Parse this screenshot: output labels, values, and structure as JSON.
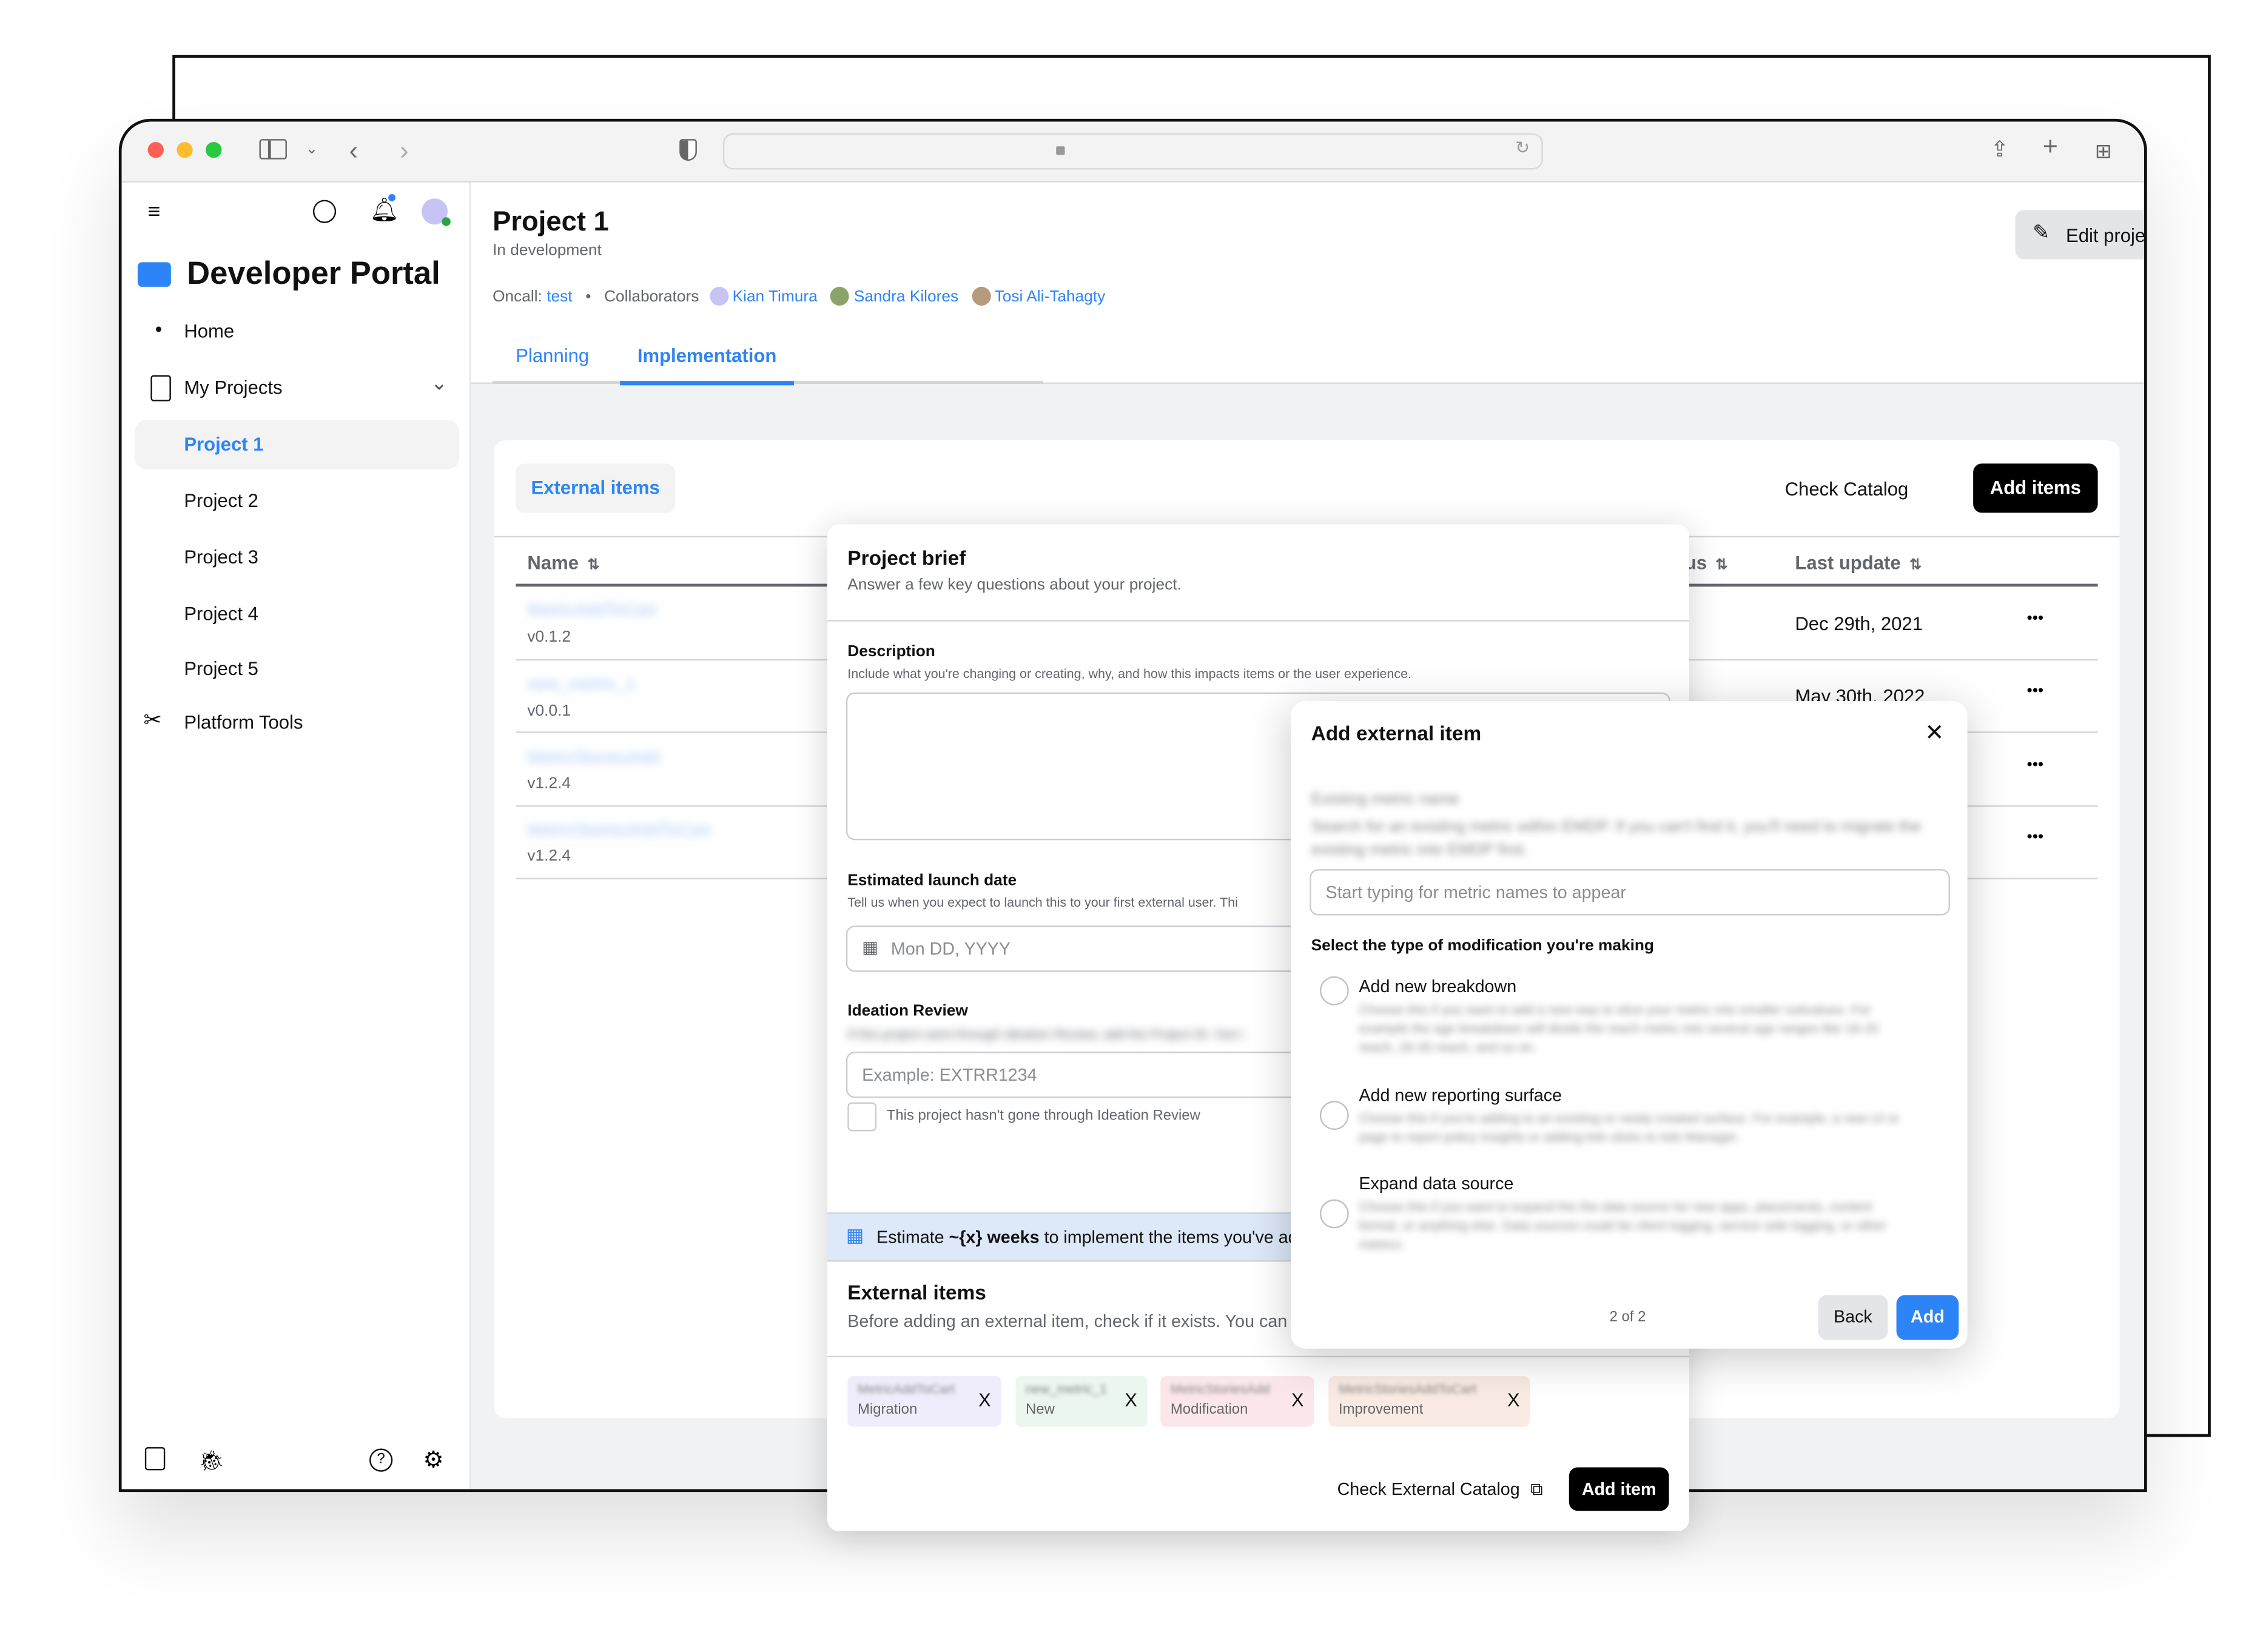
{
  "browser": {
    "traffic_lights": {
      "close": "#fe5f57",
      "minimize": "#febc2e",
      "zoom": "#28c840"
    },
    "icons": [
      "sidebar-toggle-icon",
      "chevron-down-icon",
      "back-icon",
      "forward-icon",
      "shield-icon",
      "lock-icon",
      "reload-icon",
      "share-icon",
      "new-tab-icon",
      "tab-overview-icon"
    ]
  },
  "sidebar": {
    "app_title": "Developer Portal",
    "items": [
      {
        "label": "Home",
        "icon": "bullet"
      },
      {
        "label": "My Projects",
        "icon": "document-icon",
        "expanded": true
      },
      {
        "label": "Project 1",
        "active": true
      },
      {
        "label": "Project 2"
      },
      {
        "label": "Project 3"
      },
      {
        "label": "Project 4"
      },
      {
        "label": "Project 5"
      },
      {
        "label": "Platform Tools",
        "icon": "tools-icon"
      }
    ],
    "bottom_icons": [
      "collapse-sidebar-icon",
      "bug-icon",
      "help-icon",
      "settings-icon"
    ]
  },
  "header": {
    "title": "Project 1",
    "status": "In development",
    "oncall_label": "Oncall:",
    "oncall_value": "test",
    "collaborators_label": "Collaborators",
    "collaborators": [
      "Kian Timura",
      "Sandra Kilores",
      "Tosi Ali-Tahagty"
    ],
    "edit_button": "Edit project",
    "more_button": "•••",
    "tabs": [
      {
        "label": "Planning",
        "active": false
      },
      {
        "label": "Implementation",
        "active": true
      }
    ]
  },
  "card": {
    "chip_label": "External items",
    "check_catalog": "Check Catalog",
    "add_items": "Add items",
    "columns": [
      "Name",
      "us",
      "Last update"
    ],
    "rows": [
      {
        "name": "MetricAddToCart",
        "version": "v0.1.2",
        "last_update": "Dec 29th, 2021"
      },
      {
        "name": "new_metric_1",
        "version": "v0.0.1",
        "last_update": "May 30th, 2022"
      },
      {
        "name": "MetricStoriesAdd",
        "version": "v1.2.4",
        "last_update": ""
      },
      {
        "name": "MetricStoriesAddToCart",
        "version": "v1.2.4",
        "last_update": ""
      }
    ],
    "row_menu": "•••"
  },
  "brief": {
    "title": "Project brief",
    "subtitle": "Answer a few key questions about your project.",
    "description_label": "Description",
    "description_help": "Include what you're changing or creating, why, and how this impacts items or the user experience.",
    "launch_label": "Estimated launch date",
    "launch_help": "Tell us when you expect to launch this to your first external user. Thi",
    "launch_placeholder": "Mon DD, YYYY",
    "ideation_label": "Ideation Review",
    "ideation_help": "If this project went through Ideation Review, add the Project ID. Get t",
    "ideation_placeholder": "Example: EXTRR1234",
    "ideation_checkbox": "This project hasn't gone through Ideation Review",
    "estimate_pre": "Estimate ",
    "estimate_bold": "~{x} weeks",
    "estimate_post": " to implement the items you've ad",
    "ext_title": "External items",
    "ext_help": "Before adding an external item, check if it exists. You can a",
    "chips": [
      {
        "name": "MetricAddToCart",
        "type": "Migration",
        "color": "#efedfb"
      },
      {
        "name": "new_metric_1",
        "type": "New",
        "color": "#ebf6ee"
      },
      {
        "name": "MetricStoriesAdd",
        "type": "Modification",
        "color": "#fbe7ea"
      },
      {
        "name": "MetricStoriesAddToCart",
        "type": "Improvement",
        "color": "#f9ebe3"
      }
    ],
    "chip_remove": "X",
    "check_external": "Check External Catalog",
    "add_item": "Add item"
  },
  "add_modal": {
    "title": "Add external item",
    "close": "✕",
    "field_label": "Existing metric name",
    "field_help": "Search for an existing metric within EMDP. If you can't find it, you'll need to migrate the existing metric into EMDP first.",
    "search_placeholder": "Start typing for metric names to appear",
    "type_label": "Select the type of modification you're making",
    "options": [
      {
        "title": "Add new breakdown",
        "desc": "Choose this if you want to add a new way to slice your metric into smaller subvalues. For example the age breakdown will divide the reach metric into several age ranges like 18-25 reach, 26-35 reach, and so on."
      },
      {
        "title": "Add new reporting surface",
        "desc": "Choose this if you're adding to an existing or newly created surface. For example, a new UI or page to report policy insights or adding link clicks to Ads Manager."
      },
      {
        "title": "Expand data source",
        "desc": "Choose this if you want to expand the the data source for new apps, placements, content format, or anything else. Data sources could be client logging, service side logging, or other metrics."
      }
    ],
    "step": "2 of 2",
    "back": "Back",
    "add": "Add"
  },
  "colors": {
    "accent": "#2d84f7",
    "primary_dark": "#000000"
  }
}
